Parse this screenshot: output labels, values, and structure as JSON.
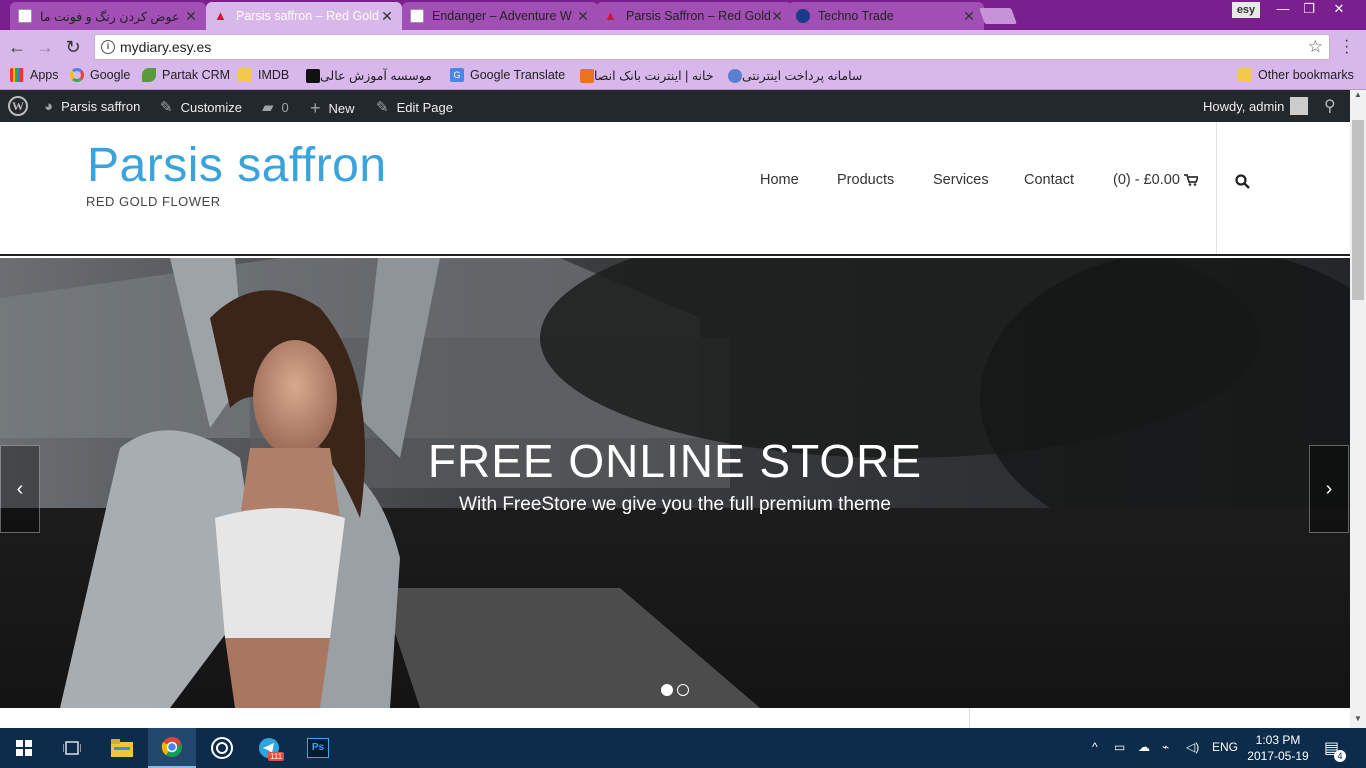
{
  "browser": {
    "tabs": [
      {
        "title": "عوض کردن رنگ و فونت ما",
        "active": false
      },
      {
        "title": "Parsis saffron – Red Gold",
        "active": true
      },
      {
        "title": "Endanger – Adventure W",
        "active": false
      },
      {
        "title": "Parsis Saffron – Red Gold",
        "active": false
      },
      {
        "title": "Techno Trade",
        "active": false
      }
    ],
    "profile": "esy",
    "url": "mydiary.esy.es",
    "bookmarks": [
      {
        "label": "Apps"
      },
      {
        "label": "Google"
      },
      {
        "label": "Partak CRM"
      },
      {
        "label": "IMDB"
      },
      {
        "label": "موسسه آموزش عالی"
      },
      {
        "label": "Google Translate"
      },
      {
        "label": "خانه | اینترنت بانک انصا"
      },
      {
        "label": "سامانه پرداخت اینترنتی"
      }
    ],
    "other_bookmarks": "Other bookmarks"
  },
  "adminbar": {
    "site": "Parsis saffron",
    "customize": "Customize",
    "comments": "0",
    "new": "New",
    "edit": "Edit Page",
    "howdy": "Howdy, admin"
  },
  "site": {
    "title": "Parsis saffron",
    "tagline": "RED GOLD FLOWER",
    "menu": [
      "Home",
      "Products",
      "Services",
      "Contact"
    ],
    "cart": "(0) - £0.00"
  },
  "hero": {
    "title": "FREE ONLINE STORE",
    "subtitle": "With FreeStore we give you the full premium theme",
    "active_slide": 1,
    "slides": 2
  },
  "taskbar": {
    "lang": "ENG",
    "time": "1:03 PM",
    "date": "2017-05-19",
    "telegram_badge": "111",
    "notif_count": "4"
  },
  "colors": {
    "tabstrip": "#7a1f8e",
    "toolbar": "#d8b8ea",
    "site_title": "#3aa3dc",
    "adminbar": "#23282d",
    "taskbar": "#0d2c4b"
  }
}
